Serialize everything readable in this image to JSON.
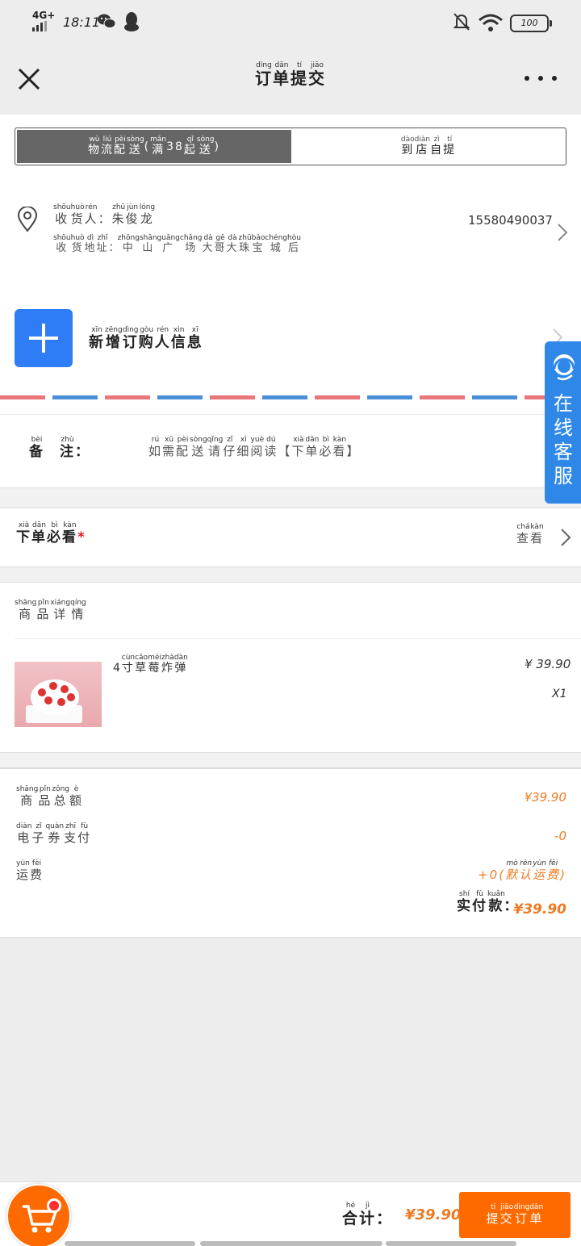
{
  "status_bar": {
    "network": "4G+",
    "time": "18:11",
    "battery": "100"
  },
  "header": {
    "title": [
      [
        "订",
        "dìng"
      ],
      [
        "单",
        "dān"
      ],
      [
        "提",
        "tí"
      ],
      [
        "交",
        "jiāo"
      ]
    ]
  },
  "tabs": [
    {
      "label": [
        [
          "物",
          "wù"
        ],
        [
          "流",
          "liú"
        ],
        [
          "配",
          "pèi"
        ],
        [
          "送",
          "sòng"
        ],
        [
          "(",
          ""
        ],
        [
          "满",
          "mǎn"
        ],
        [
          "38",
          ""
        ],
        [
          "起",
          "qǐ"
        ],
        [
          "送",
          "sòng"
        ],
        [
          ")",
          ""
        ]
      ],
      "active": true
    },
    {
      "label": [
        [
          "到",
          "dào"
        ],
        [
          "店",
          "diàn"
        ],
        [
          "自",
          "zì"
        ],
        [
          "提",
          "tí"
        ]
      ],
      "active": false
    }
  ],
  "address": {
    "receiver": [
      [
        "收",
        "shōu"
      ],
      [
        "货",
        "huò"
      ],
      [
        "人",
        "rén"
      ],
      [
        "：",
        ""
      ],
      [
        "朱",
        "zhū"
      ],
      [
        "俊",
        "jùn"
      ],
      [
        "龙",
        "lóng"
      ]
    ],
    "phone": "15580490037",
    "location": [
      [
        "收",
        "shōu"
      ],
      [
        "货",
        "huò"
      ],
      [
        "地",
        "dì"
      ],
      [
        "址",
        "zhǐ"
      ],
      [
        "：",
        ""
      ],
      [
        "中",
        "zhōng"
      ],
      [
        "山",
        "shān"
      ],
      [
        "广",
        "guǎng"
      ],
      [
        "场",
        "chǎng"
      ],
      [
        "大",
        "dà"
      ],
      [
        "哥",
        "gē"
      ],
      [
        "大",
        "dà"
      ],
      [
        "珠",
        "zhū"
      ],
      [
        "宝",
        "bǎo"
      ],
      [
        "城",
        "chéng"
      ],
      [
        "后",
        "hòu"
      ]
    ]
  },
  "new_buyer": {
    "label": [
      [
        "新",
        "xīn"
      ],
      [
        "增",
        "zēng"
      ],
      [
        "订",
        "dìng"
      ],
      [
        "购",
        "gòu"
      ],
      [
        "人",
        "rén"
      ],
      [
        "信",
        "xìn"
      ],
      [
        "息",
        "xī"
      ]
    ]
  },
  "remark": {
    "label": [
      [
        "备",
        "bèi"
      ],
      [
        "　",
        ""
      ],
      [
        "注",
        "zhù"
      ],
      [
        "：",
        ""
      ]
    ],
    "placeholder": [
      [
        "如",
        "rú"
      ],
      [
        "需",
        "xū"
      ],
      [
        "配",
        "pèi"
      ],
      [
        "送",
        "sòng"
      ],
      [
        "请",
        "qǐng"
      ],
      [
        "仔",
        "zǐ"
      ],
      [
        "细",
        "xì"
      ],
      [
        "阅",
        "yuè"
      ],
      [
        "读",
        "dú"
      ],
      [
        "【",
        ""
      ],
      [
        "下",
        "xià"
      ],
      [
        "单",
        "dān"
      ],
      [
        "必",
        "bì"
      ],
      [
        "看",
        "kàn"
      ],
      [
        "】",
        ""
      ]
    ]
  },
  "notice": {
    "label": [
      [
        "下",
        "xià"
      ],
      [
        "单",
        "dān"
      ],
      [
        "必",
        "bì"
      ],
      [
        "看",
        "kàn"
      ]
    ],
    "star": "*",
    "view": [
      [
        "查",
        "chá"
      ],
      [
        "看",
        "kàn"
      ]
    ]
  },
  "goods": {
    "title": [
      [
        "商",
        "shāng"
      ],
      [
        "品",
        "pǐn"
      ],
      [
        "详",
        "xiáng"
      ],
      [
        "情",
        "qíng"
      ]
    ],
    "items": [
      {
        "name": [
          [
            "4",
            ""
          ],
          [
            "寸",
            "cùn"
          ],
          [
            "草",
            "cǎo"
          ],
          [
            "莓",
            "méi"
          ],
          [
            "炸",
            "zhà"
          ],
          [
            "弹",
            "dàn"
          ]
        ],
        "price": "¥ 39.90",
        "qty": "X1"
      }
    ]
  },
  "summary": {
    "subtotal_label": [
      [
        "商",
        "shāng"
      ],
      [
        "品",
        "pǐn"
      ],
      [
        "总",
        "zǒng"
      ],
      [
        "额",
        "è"
      ]
    ],
    "subtotal": "¥39.90",
    "coupon_label": [
      [
        "电",
        "diàn"
      ],
      [
        "子",
        "zǐ"
      ],
      [
        "券",
        "quàn"
      ],
      [
        "支",
        "zhī"
      ],
      [
        "付",
        "fù"
      ]
    ],
    "coupon": "-0",
    "shipping_label": [
      [
        "运",
        "yùn"
      ],
      [
        "费",
        "fèi"
      ]
    ],
    "shipping": [
      [
        "+0(",
        ""
      ],
      [
        "默",
        "mò"
      ],
      [
        "认",
        "rèn"
      ],
      [
        "运",
        "yùn"
      ],
      [
        "费",
        "fèi"
      ],
      [
        ")",
        ""
      ]
    ],
    "paid_label": [
      [
        "实",
        "shí"
      ],
      [
        "付",
        "fù"
      ],
      [
        "款",
        "kuǎn"
      ],
      [
        "：",
        ""
      ]
    ],
    "paid": "¥39.90"
  },
  "service": {
    "text": "在线客服"
  },
  "bottom": {
    "total_label": [
      [
        "合",
        "hé"
      ],
      [
        "计",
        "jì"
      ],
      [
        "：",
        ""
      ]
    ],
    "total": "¥39.90",
    "submit": [
      [
        "提",
        "tí"
      ],
      [
        "交",
        "jiāo"
      ],
      [
        "订",
        "dìng"
      ],
      [
        "单",
        "dān"
      ]
    ]
  },
  "colors": {
    "accent": "#ff6a00",
    "price": "#f07a22",
    "blue": "#2e7cf6",
    "service": "#2f88e8"
  }
}
